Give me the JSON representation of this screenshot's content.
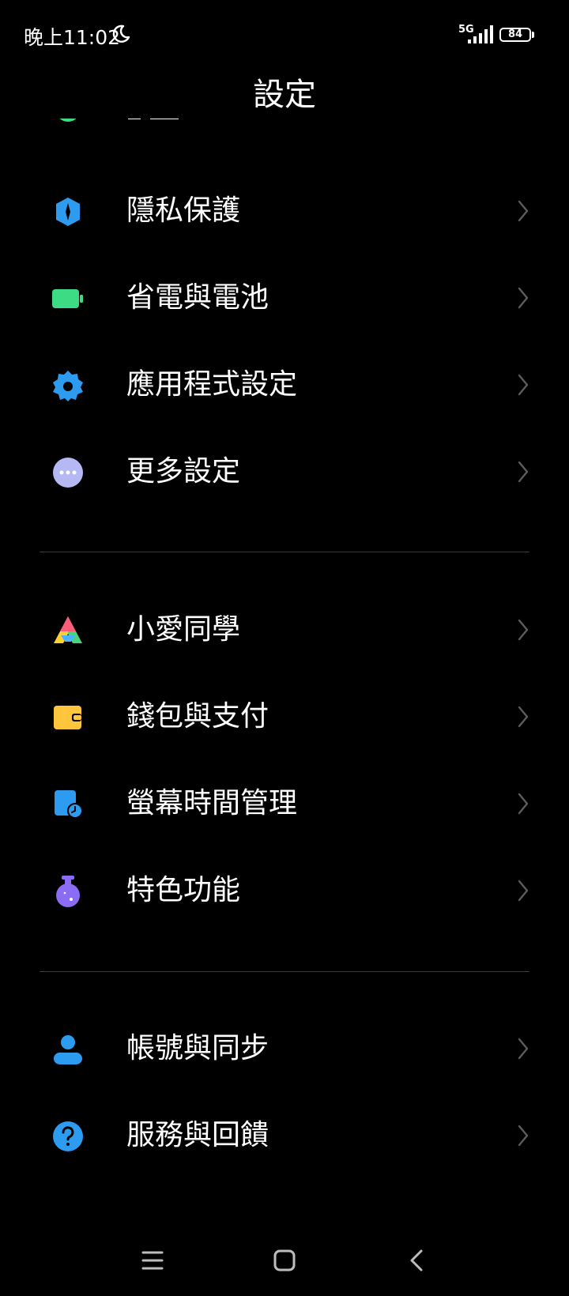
{
  "status_bar": {
    "time": "晚上11:02",
    "network": "5G",
    "battery": "84"
  },
  "header": {
    "title": "設定"
  },
  "groups": [
    {
      "items": [
        {
          "label": "隱私保護",
          "icon": "privacy-shield-icon",
          "color": "#2d9cf0"
        },
        {
          "label": "省電與電池",
          "icon": "battery-icon",
          "color": "#3ddc84"
        },
        {
          "label": "應用程式設定",
          "icon": "gear-icon",
          "color": "#2d9cf0"
        },
        {
          "label": "更多設定",
          "icon": "more-dots-icon",
          "color": "#b6b8f4"
        }
      ]
    },
    {
      "items": [
        {
          "label": "小愛同學",
          "icon": "xiaoai-assistant-icon",
          "color": "#ff5c7a"
        },
        {
          "label": "錢包與支付",
          "icon": "wallet-icon",
          "color": "#ffc53d"
        },
        {
          "label": "螢幕時間管理",
          "icon": "screen-time-icon",
          "color": "#2d9cf0"
        },
        {
          "label": "特色功能",
          "icon": "flask-icon",
          "color": "#8a6cf5"
        }
      ]
    },
    {
      "items": [
        {
          "label": "帳號與同步",
          "icon": "account-icon",
          "color": "#2d9cf0"
        },
        {
          "label": "服務與回饋",
          "icon": "help-icon",
          "color": "#2d9cf0"
        }
      ]
    }
  ]
}
